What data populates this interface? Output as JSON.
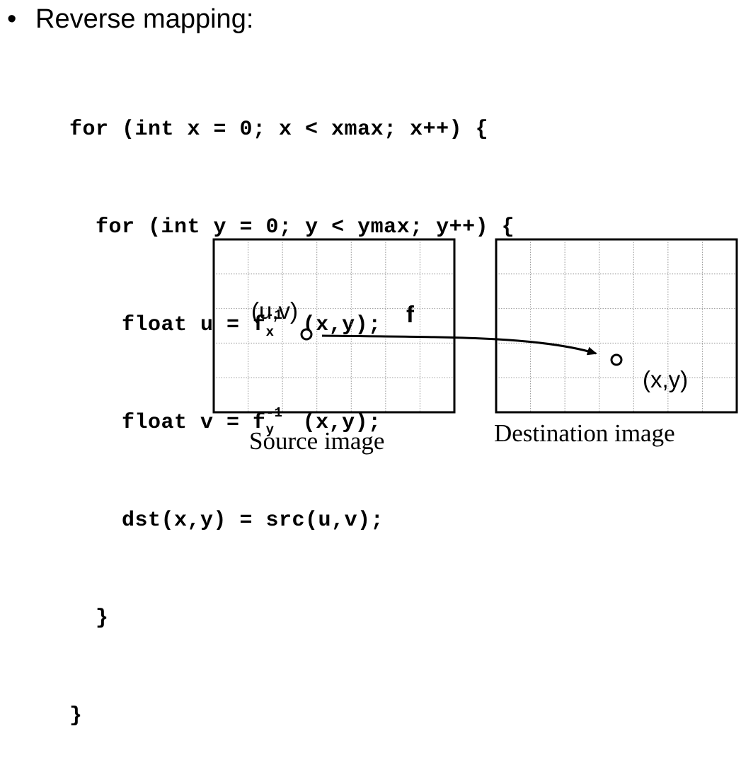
{
  "heading": {
    "bullet": "•",
    "text": "Reverse mapping:"
  },
  "code": {
    "line1": "for (int x = 0; x < xmax; x++) {",
    "line2": "for (int y = 0; y < ymax; y++) {",
    "line3_a": "float u = f",
    "line3_sub": "x",
    "line3_sup": "-1",
    "line3_b": "(x,y);",
    "line4_a": "float v = f",
    "line4_sub": "y",
    "line4_sup": "-1",
    "line4_b": "(x,y);",
    "line5": "dst(x,y) = src(u,v);",
    "line6": "}",
    "line7": "}"
  },
  "diagram": {
    "source_point_label": "(u,v)",
    "dest_point_label": "(x,y)",
    "mapping_label": "f",
    "source_caption": "Source image",
    "dest_caption": "Destination image",
    "grid_columns": 7,
    "grid_rows": 5
  }
}
